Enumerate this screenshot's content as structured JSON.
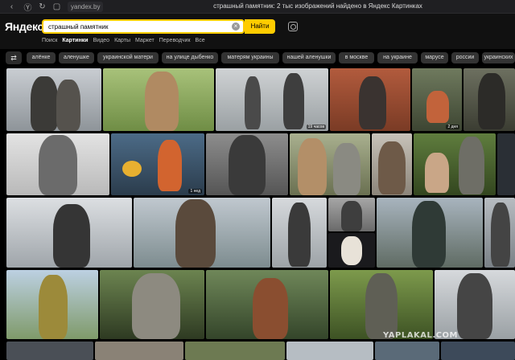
{
  "browser": {
    "url": "yandex.by",
    "title": "страшный памятник: 2 тыс изображений найдено в Яндекс Картинках"
  },
  "header": {
    "logo": "Яндекс",
    "search_value": "страшный памятник",
    "find_label": "Найти",
    "tabs": [
      {
        "label": "Поиск"
      },
      {
        "label": "Картинки"
      },
      {
        "label": "Видео"
      },
      {
        "label": "Карты"
      },
      {
        "label": "Маркет"
      },
      {
        "label": "Переводчик"
      },
      {
        "label": "Все"
      }
    ]
  },
  "tags": [
    {
      "label": "алёнке"
    },
    {
      "label": "аленушке"
    },
    {
      "label": "украинской матери"
    },
    {
      "label": "на улице дыбенко"
    },
    {
      "label": "матерям украины"
    },
    {
      "label": "нашей аленушки"
    },
    {
      "label": "в москве"
    },
    {
      "label": "на украине"
    },
    {
      "label": "марусе"
    },
    {
      "label": "россии"
    },
    {
      "label": "украинских"
    }
  ],
  "images": [
    {
      "caption": ""
    },
    {
      "caption": ""
    },
    {
      "caption": "19 часов"
    },
    {
      "caption": ""
    },
    {
      "caption": "2 дня"
    },
    {
      "caption": ""
    },
    {
      "caption": ""
    },
    {
      "caption": "1 нед"
    },
    {
      "caption": ""
    },
    {
      "caption": ""
    },
    {
      "caption": ""
    },
    {
      "caption": ""
    },
    {
      "caption": ""
    }
  ],
  "watermark": "YAPLAKAL.COM"
}
